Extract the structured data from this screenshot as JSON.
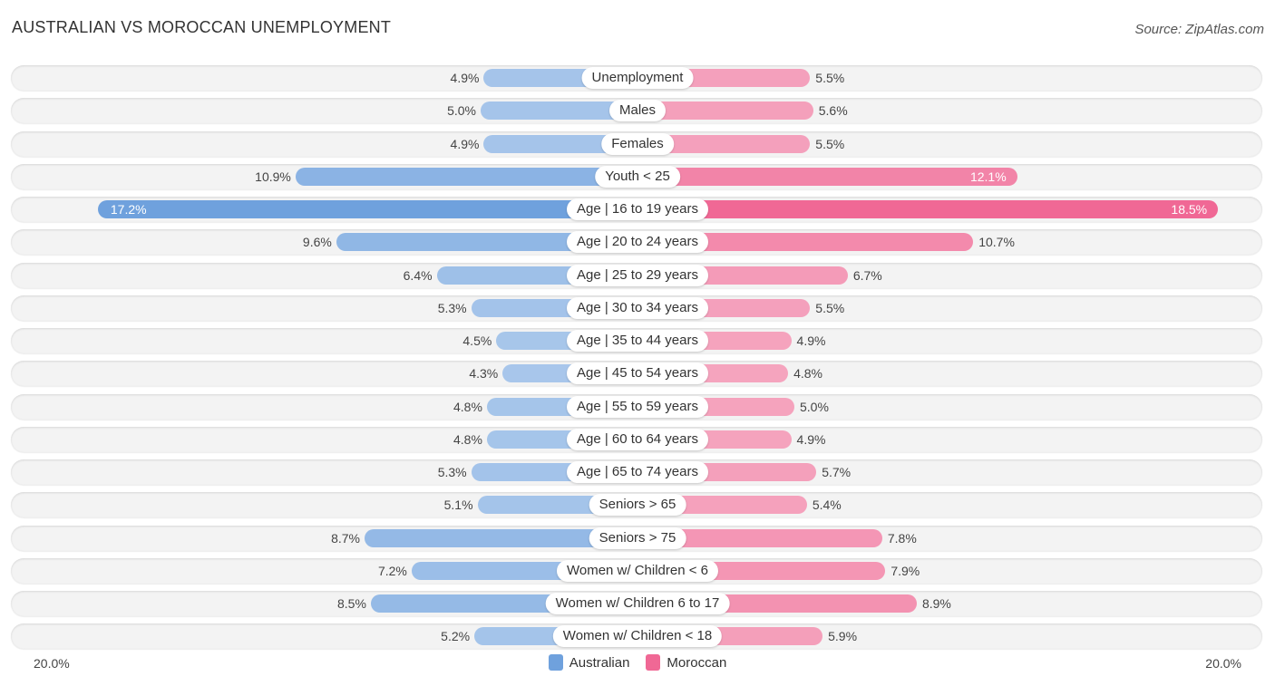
{
  "header": {
    "title": "AUSTRALIAN VS MOROCCAN UNEMPLOYMENT",
    "source": "Source: ZipAtlas.com"
  },
  "colors": {
    "australian": "#6fa1dd",
    "australian_light": "#a9c7eb",
    "moroccan": "#f06895",
    "moroccan_light": "#f5a7c0"
  },
  "chart_data": {
    "type": "bar",
    "orientation": "horizontal-diverging",
    "title": "AUSTRALIAN VS MOROCCAN UNEMPLOYMENT",
    "categories": [
      "Unemployment",
      "Males",
      "Females",
      "Youth < 25",
      "Age | 16 to 19 years",
      "Age | 20 to 24 years",
      "Age | 25 to 29 years",
      "Age | 30 to 34 years",
      "Age | 35 to 44 years",
      "Age | 45 to 54 years",
      "Age | 55 to 59 years",
      "Age | 60 to 64 years",
      "Age | 65 to 74 years",
      "Seniors > 65",
      "Seniors > 75",
      "Women w/ Children < 6",
      "Women w/ Children 6 to 17",
      "Women w/ Children < 18"
    ],
    "series": [
      {
        "name": "Australian",
        "side": "left",
        "values": [
          4.9,
          5.0,
          4.9,
          10.9,
          17.2,
          9.6,
          6.4,
          5.3,
          4.5,
          4.3,
          4.8,
          4.8,
          5.3,
          5.1,
          8.7,
          7.2,
          8.5,
          5.2
        ],
        "labels": [
          "4.9%",
          "5.0%",
          "4.9%",
          "10.9%",
          "17.2%",
          "9.6%",
          "6.4%",
          "5.3%",
          "4.5%",
          "4.3%",
          "4.8%",
          "4.8%",
          "5.3%",
          "5.1%",
          "8.7%",
          "7.2%",
          "8.5%",
          "5.2%"
        ]
      },
      {
        "name": "Moroccan",
        "side": "right",
        "values": [
          5.5,
          5.6,
          5.5,
          12.1,
          18.5,
          10.7,
          6.7,
          5.5,
          4.9,
          4.8,
          5.0,
          4.9,
          5.7,
          5.4,
          7.8,
          7.9,
          8.9,
          5.9
        ],
        "labels": [
          "5.5%",
          "5.6%",
          "5.5%",
          "12.1%",
          "18.5%",
          "10.7%",
          "6.7%",
          "5.5%",
          "4.9%",
          "4.8%",
          "5.0%",
          "4.9%",
          "5.7%",
          "5.4%",
          "7.8%",
          "7.9%",
          "8.9%",
          "5.9%"
        ]
      }
    ],
    "xlim": [
      -20,
      20
    ],
    "axis_labels": {
      "left": "20.0%",
      "right": "20.0%"
    },
    "legend": {
      "position": "bottom-center",
      "entries": [
        "Australian",
        "Moroccan"
      ]
    },
    "grid": false
  }
}
